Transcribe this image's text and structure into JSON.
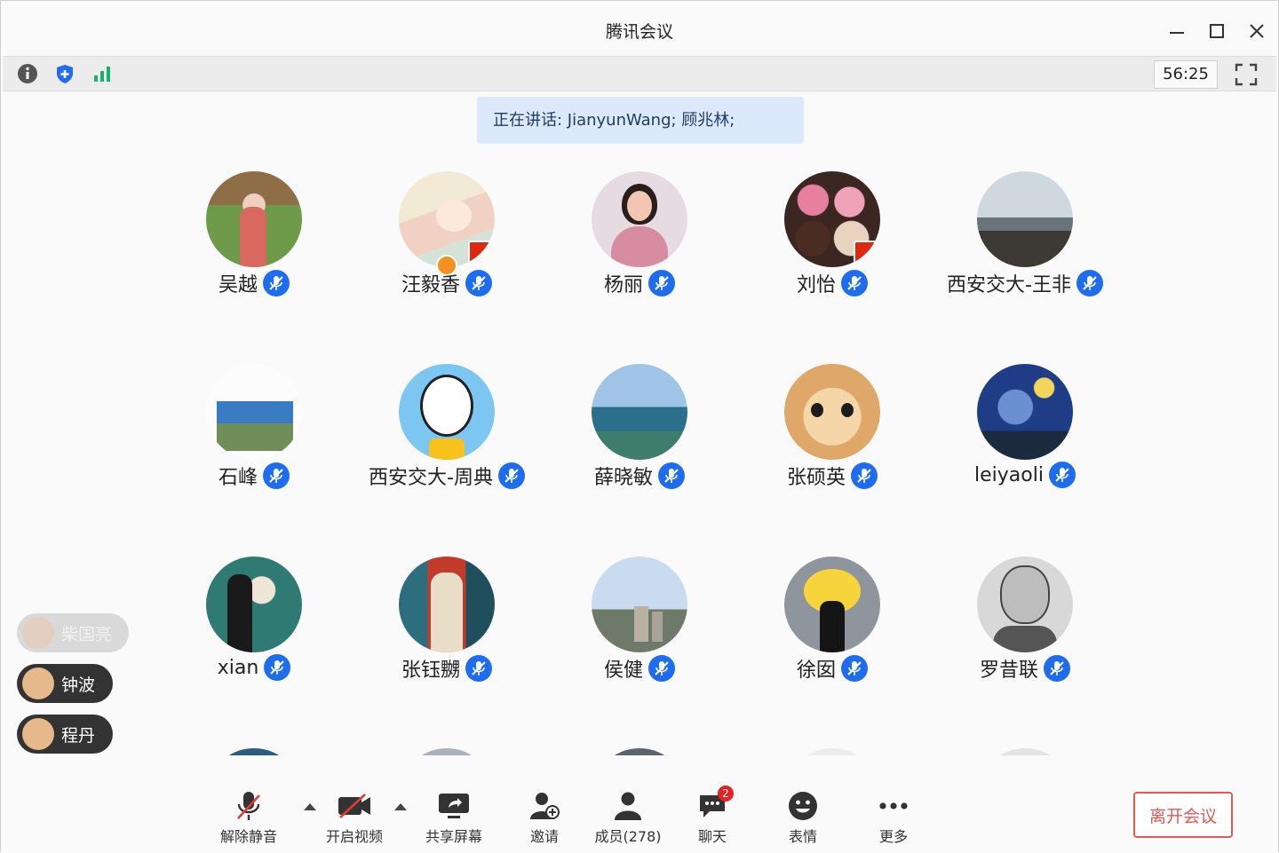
{
  "window": {
    "title": "腾讯会议"
  },
  "toolbar": {
    "timer": "56:25"
  },
  "speaking": {
    "text": "正在讲话: JianyunWang; 顾兆林;"
  },
  "participants": [
    {
      "name": "吴越"
    },
    {
      "name": "汪毅香"
    },
    {
      "name": "杨丽"
    },
    {
      "name": "刘怡"
    },
    {
      "name": "西安交大-王非"
    },
    {
      "name": "石峰"
    },
    {
      "name": "西安交大-周典"
    },
    {
      "name": "薛晓敏"
    },
    {
      "name": "张硕英"
    },
    {
      "name": "leiyaoli"
    },
    {
      "name": "xian"
    },
    {
      "name": "张钰嬲"
    },
    {
      "name": "侯健"
    },
    {
      "name": "徐囡"
    },
    {
      "name": "罗昔联"
    }
  ],
  "raised_hands": [
    {
      "name": "柴国亮"
    },
    {
      "name": "钟波"
    },
    {
      "name": "程丹"
    }
  ],
  "controls": {
    "unmute": "解除静音",
    "start_video": "开启视频",
    "share_screen": "共享屏幕",
    "invite": "邀请",
    "members": "成员(278)",
    "chat": "聊天",
    "chat_badge": "2",
    "reactions": "表情",
    "more": "更多",
    "leave": "离开会议"
  },
  "colors": {
    "accent": "#1e6cf0",
    "leave": "#e15858",
    "speaking_bg": "#dce9fc"
  }
}
